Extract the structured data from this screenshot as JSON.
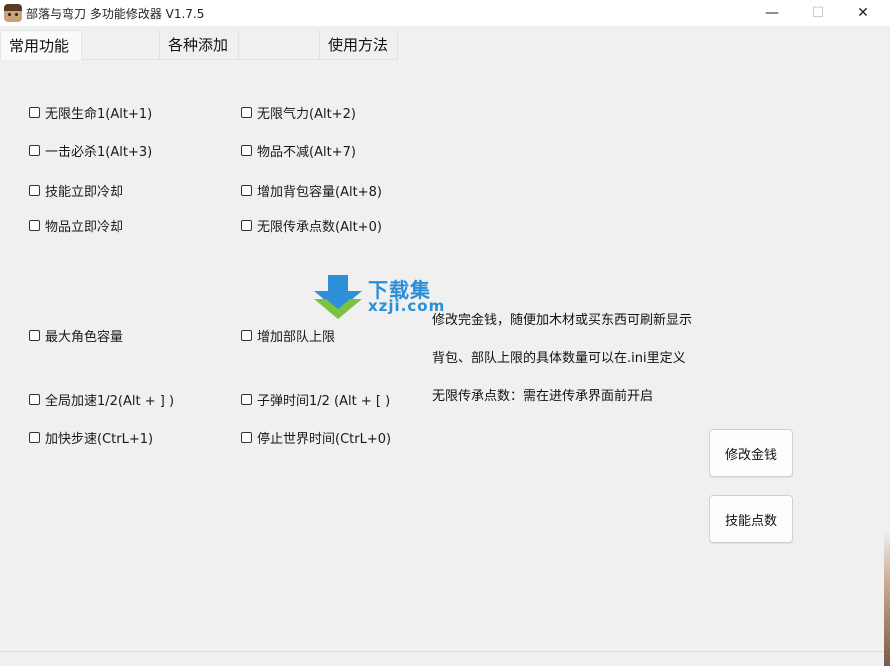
{
  "window": {
    "title": "部落与弯刀 多功能修改器  V1.7.5",
    "icon": "app-face-icon",
    "min_glyph": "—",
    "max_glyph": "☐",
    "close_glyph": "✕"
  },
  "tabs": [
    {
      "label": "常用功能",
      "active": true
    },
    {
      "label": ""
    },
    {
      "label": "各种添加"
    },
    {
      "label": ""
    },
    {
      "label": "使用方法"
    }
  ],
  "checkboxes": [
    {
      "label": "无限生命1(Alt+1)",
      "checked": false
    },
    {
      "label": "无限气力(Alt+2)",
      "checked": false
    },
    {
      "label": "一击必杀1(Alt+3)",
      "checked": false
    },
    {
      "label": "物品不减(Alt+7)",
      "checked": false
    },
    {
      "label": "技能立即冷却",
      "checked": false
    },
    {
      "label": "增加背包容量(Alt+8)",
      "checked": false
    },
    {
      "label": "物品立即冷却",
      "checked": false
    },
    {
      "label": "无限传承点数(Alt+0)",
      "checked": false
    },
    {
      "label": "最大角色容量",
      "checked": false
    },
    {
      "label": "增加部队上限",
      "checked": false
    },
    {
      "label": "全局加速1/2(Alt + ] )",
      "checked": false
    },
    {
      "label": "子弹时间1/2 (Alt + [ )",
      "checked": false
    },
    {
      "label": "加快步速(CtrL+1)",
      "checked": false
    },
    {
      "label": "停止世界时间(CtrL+0)",
      "checked": false
    }
  ],
  "info": [
    "修改完金钱，随便加木材或买东西可刷新显示",
    "背包、部队上限的具体数量可以在.ini里定义",
    "无限传承点数：需在进传承界面前开启"
  ],
  "buttons": {
    "modify_money": "修改金钱",
    "skill_points": "技能点数"
  },
  "watermark": {
    "line1": "下载集",
    "line2": "xzji.com"
  }
}
